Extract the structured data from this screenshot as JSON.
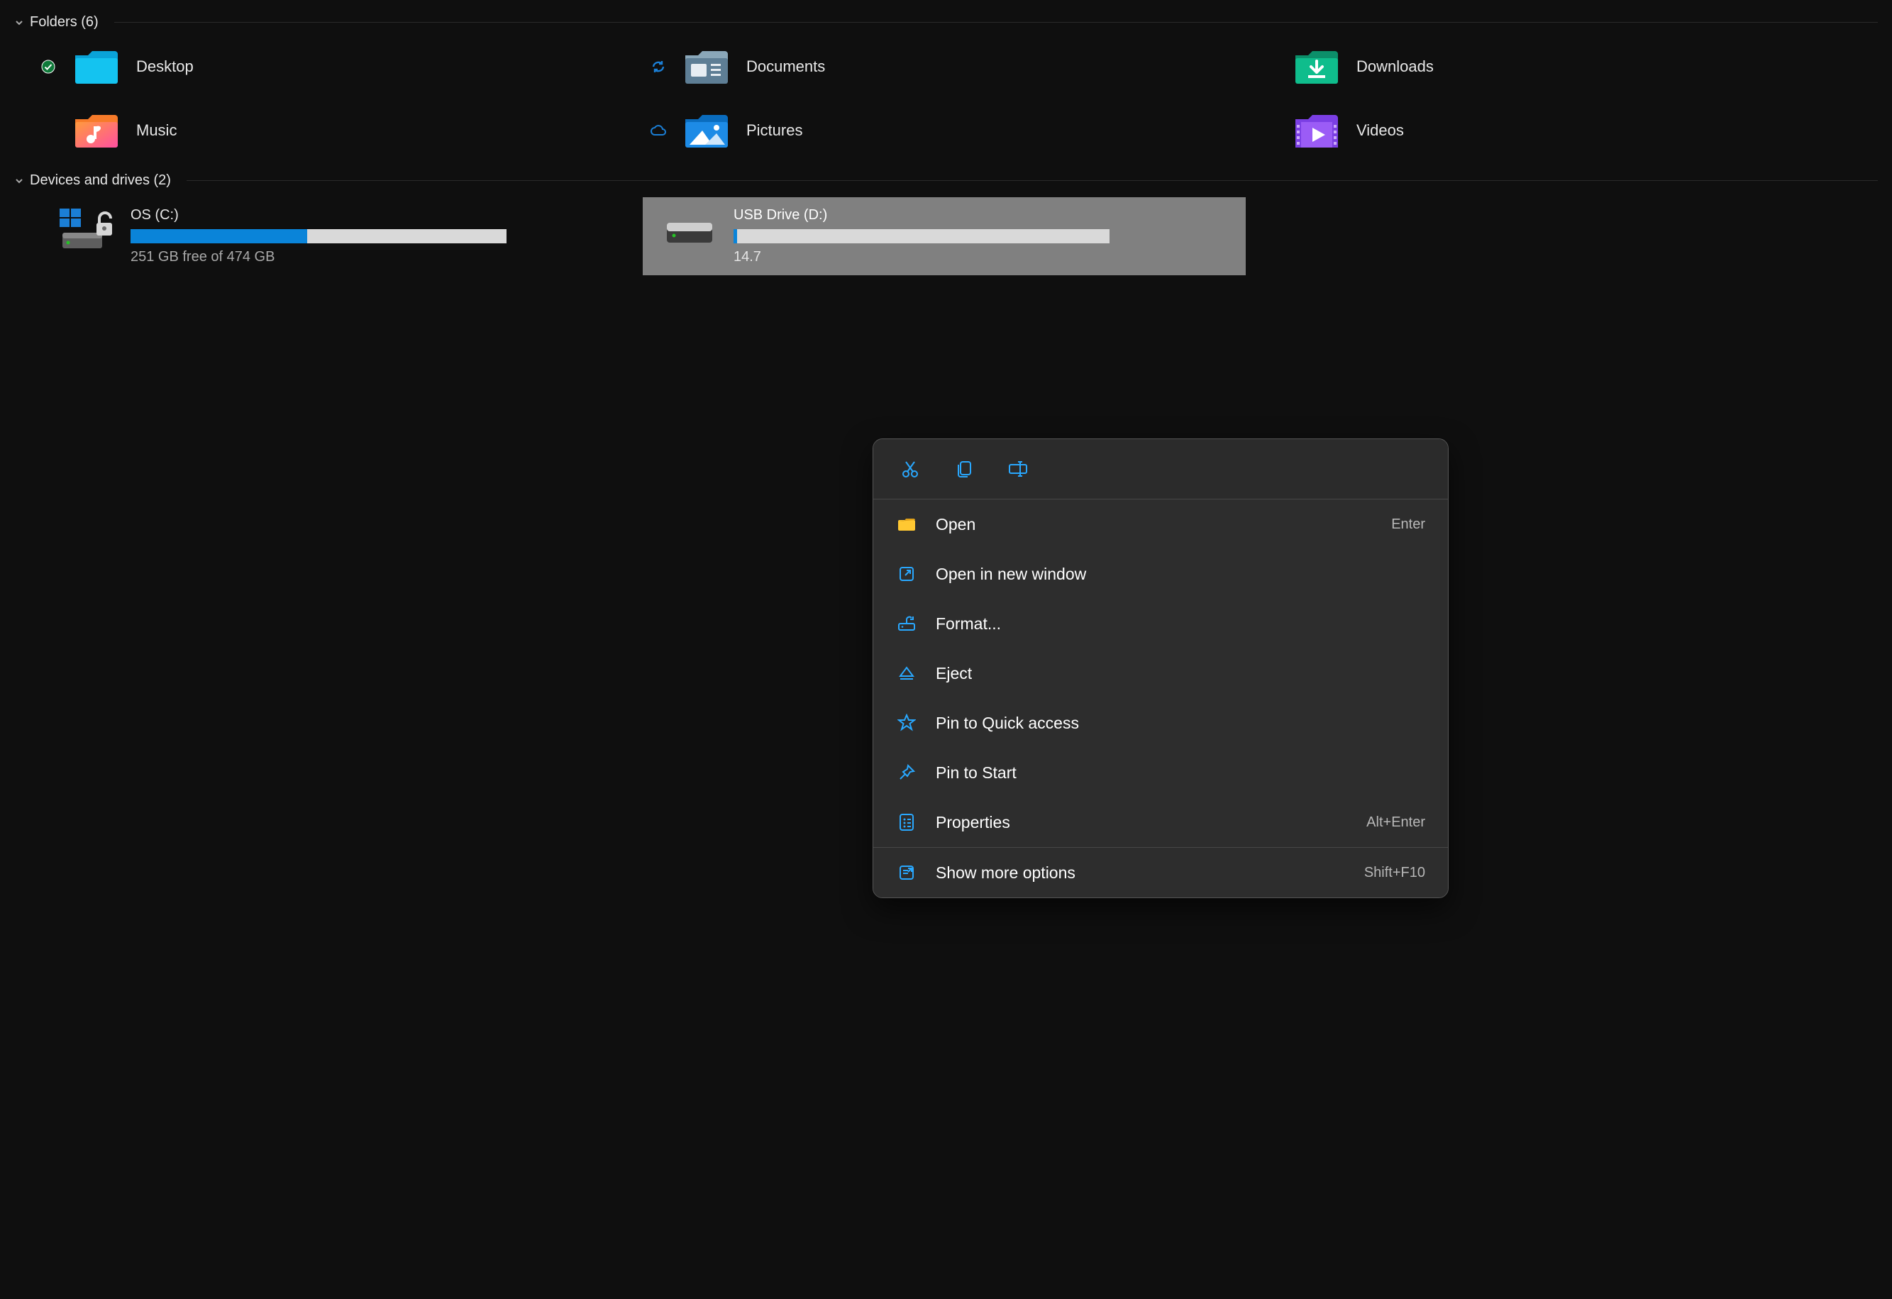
{
  "folders_group": {
    "title": "Folders",
    "count": 6,
    "header_label": "Folders (6)"
  },
  "drives_group": {
    "title": "Devices and drives",
    "count": 2,
    "header_label": "Devices and drives (2)"
  },
  "folders": [
    {
      "label": "Desktop",
      "icon": "folder-desktop",
      "overlay": "synced"
    },
    {
      "label": "Documents",
      "icon": "folder-documents",
      "overlay": "syncing"
    },
    {
      "label": "Downloads",
      "icon": "folder-downloads",
      "overlay": null
    },
    {
      "label": "Music",
      "icon": "folder-music",
      "overlay": null
    },
    {
      "label": "Pictures",
      "icon": "folder-pictures",
      "overlay": "cloud"
    },
    {
      "label": "Videos",
      "icon": "folder-videos",
      "overlay": null
    }
  ],
  "drives": [
    {
      "title": "OS (C:)",
      "sub": "251 GB free of 474 GB",
      "fill_fraction": 0.47,
      "selected": false,
      "bitlocker_unlocked": true,
      "windows_overlay": true
    },
    {
      "title": "USB Drive (D:)",
      "sub_prefix": "14.7",
      "fill_fraction": 0.01,
      "selected": true,
      "bitlocker_unlocked": false,
      "windows_overlay": false
    }
  ],
  "context_menu": {
    "top_icons": [
      "cut",
      "copy",
      "rename"
    ],
    "items": [
      {
        "icon": "folder-open",
        "label": "Open",
        "shortcut": "Enter"
      },
      {
        "icon": "new-window",
        "label": "Open in new window",
        "shortcut": ""
      },
      {
        "icon": "format-drive",
        "label": "Format...",
        "shortcut": ""
      },
      {
        "icon": "eject",
        "label": "Eject",
        "shortcut": ""
      },
      {
        "icon": "star",
        "label": "Pin to Quick access",
        "shortcut": ""
      },
      {
        "icon": "pin",
        "label": "Pin to Start",
        "shortcut": ""
      },
      {
        "icon": "properties",
        "label": "Properties",
        "shortcut": "Alt+Enter"
      }
    ],
    "more_item": {
      "icon": "more-options",
      "label": "Show more options",
      "shortcut": "Shift+F10"
    }
  }
}
